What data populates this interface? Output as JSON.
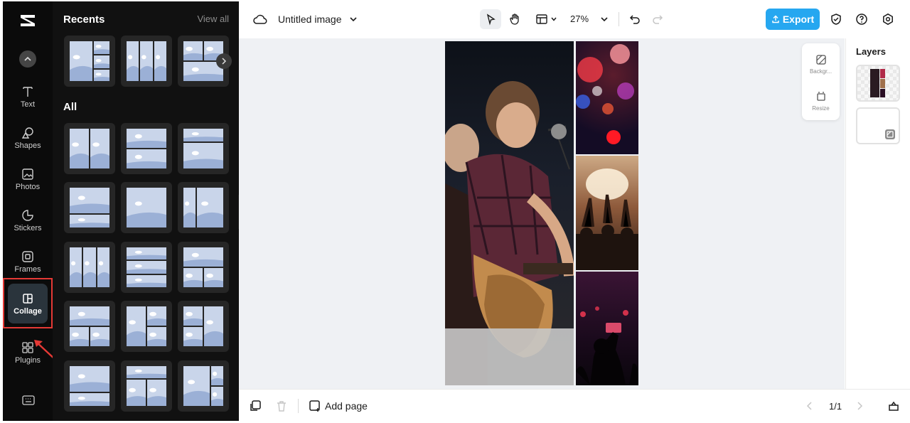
{
  "rail": {
    "items": [
      {
        "name": "text",
        "label": "Text"
      },
      {
        "name": "shapes",
        "label": "Shapes"
      },
      {
        "name": "photos",
        "label": "Photos"
      },
      {
        "name": "stickers",
        "label": "Stickers"
      },
      {
        "name": "frames",
        "label": "Frames"
      },
      {
        "name": "collage",
        "label": "Collage"
      },
      {
        "name": "plugins",
        "label": "Plugins"
      }
    ],
    "active_item": "collage",
    "highlight_color": "#e53935"
  },
  "panel": {
    "recents_title": "Recents",
    "view_all": "View all",
    "all_title": "All"
  },
  "topbar": {
    "title": "Untitled image",
    "zoom": "27%",
    "export_label": "Export",
    "export_color": "#26a7f0"
  },
  "float_tools": {
    "background_label": "Backgr...",
    "resize_label": "Resize"
  },
  "layers": {
    "title": "Layers"
  },
  "bottombar": {
    "add_page_label": "Add page",
    "page_indicator": "1/1"
  }
}
